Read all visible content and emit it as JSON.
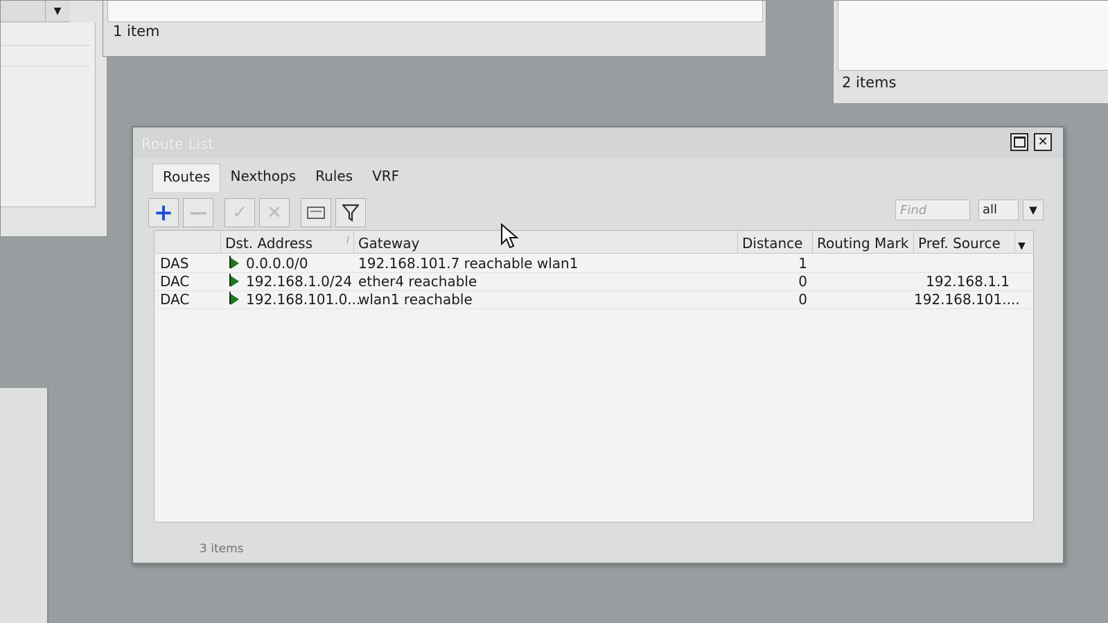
{
  "background": {
    "middle_window_count": "1 item",
    "right_window_count": "2 items"
  },
  "window": {
    "title": "Route List"
  },
  "tabs": [
    {
      "label": "Routes",
      "active": true
    },
    {
      "label": "Nexthops",
      "active": false
    },
    {
      "label": "Rules",
      "active": false
    },
    {
      "label": "VRF",
      "active": false
    }
  ],
  "toolbar": {
    "add_icon": "plus-icon",
    "remove_icon": "minus-icon",
    "enable_icon": "check-icon",
    "disable_icon": "cross-icon",
    "comment_icon": "comment-icon",
    "filter_icon": "filter-icon",
    "find_placeholder": "Find",
    "filter_value": "all"
  },
  "table": {
    "columns": {
      "dst": "Dst. Address",
      "sort": "/",
      "gateway": "Gateway",
      "distance": "Distance",
      "routing_mark": "Routing Mark",
      "pref_source": "Pref. Source"
    },
    "rows": [
      {
        "flags": "DAS",
        "dst": "0.0.0.0/0",
        "gateway": "192.168.101.7 reachable wlan1",
        "distance": "1",
        "routing_mark": "",
        "pref_source": ""
      },
      {
        "flags": "DAC",
        "dst": "192.168.1.0/24",
        "gateway": "ether4 reachable",
        "distance": "0",
        "routing_mark": "",
        "pref_source": "192.168.1.1"
      },
      {
        "flags": "DAC",
        "dst": "192.168.101.0...",
        "gateway": "wlan1 reachable",
        "distance": "0",
        "routing_mark": "",
        "pref_source": "192.168.101...."
      }
    ]
  },
  "status": {
    "count": "3 items"
  },
  "colors": {
    "add_icon": "#1b4fd6",
    "flag": "#1c7a1c"
  }
}
